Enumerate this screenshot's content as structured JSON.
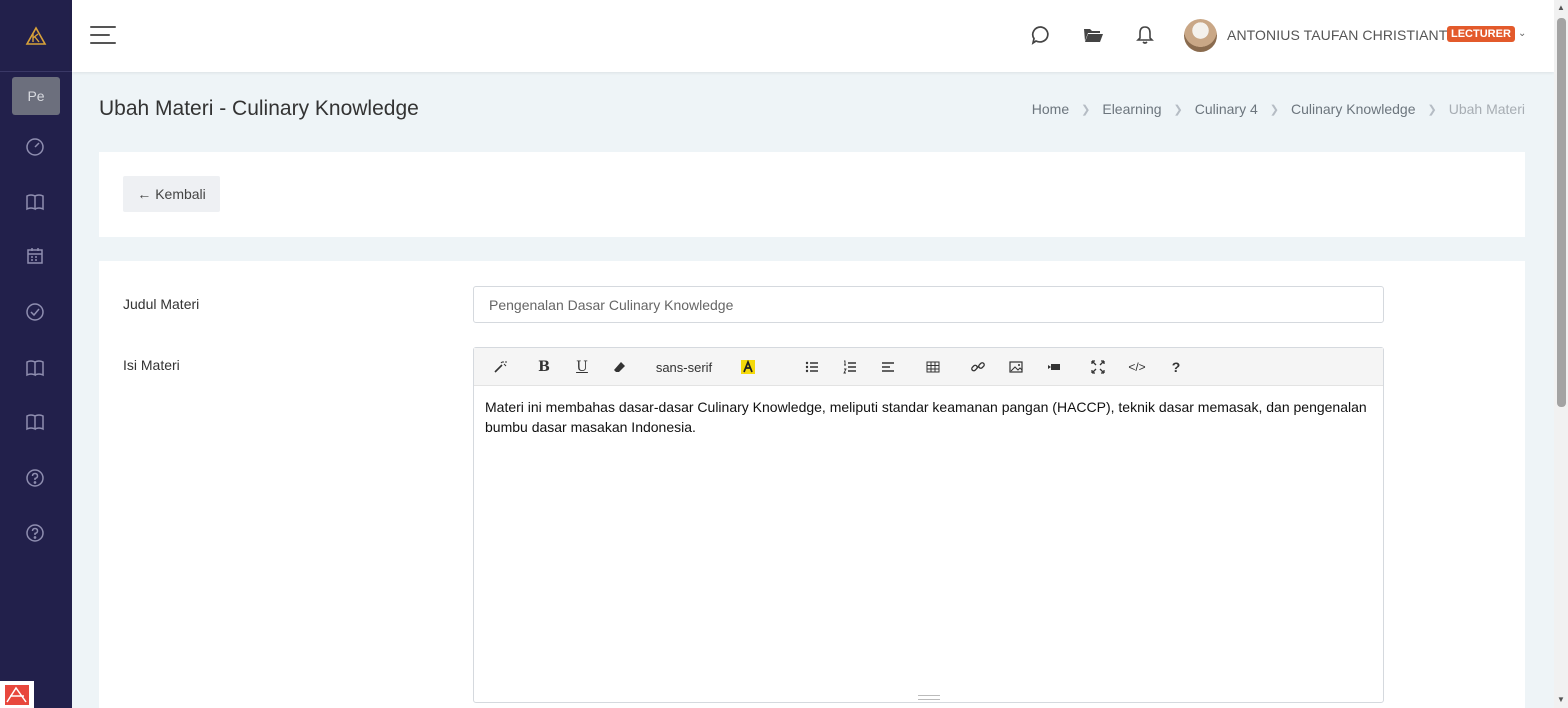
{
  "sidebar": {
    "logo_icon": "brand-logo-icon",
    "menu_short": "Pe",
    "items": [
      "dashboard-icon",
      "book-icon",
      "calendar-icon",
      "check-circle-icon",
      "book-icon",
      "book-icon",
      "help-icon",
      "help-icon"
    ]
  },
  "header": {
    "icons": [
      "chat-icon",
      "folder-icon",
      "bell-icon"
    ],
    "user_name": "ANTONIUS TAUFAN CHRISTIANTO",
    "role": "LECTURER"
  },
  "page": {
    "title": "Ubah Materi - Culinary Knowledge",
    "breadcrumb": [
      "Home",
      "Elearning",
      "Culinary 4",
      "Culinary Knowledge",
      "Ubah Materi"
    ]
  },
  "back_button": "Kembali",
  "form": {
    "title_label": "Judul Materi",
    "title_value": "Pengenalan Dasar Culinary Knowledge",
    "content_label": "Isi Materi",
    "font_name": "sans-serif",
    "content": "Materi ini membahas dasar-dasar Culinary Knowledge, meliputi standar keamanan pangan (HACCP), teknik dasar memasak, dan pengenalan bumbu dasar masakan Indonesia."
  },
  "colors": {
    "sidebar": "#22204b",
    "role_badge": "#e35a2b",
    "highlight": "#f5d90a"
  }
}
